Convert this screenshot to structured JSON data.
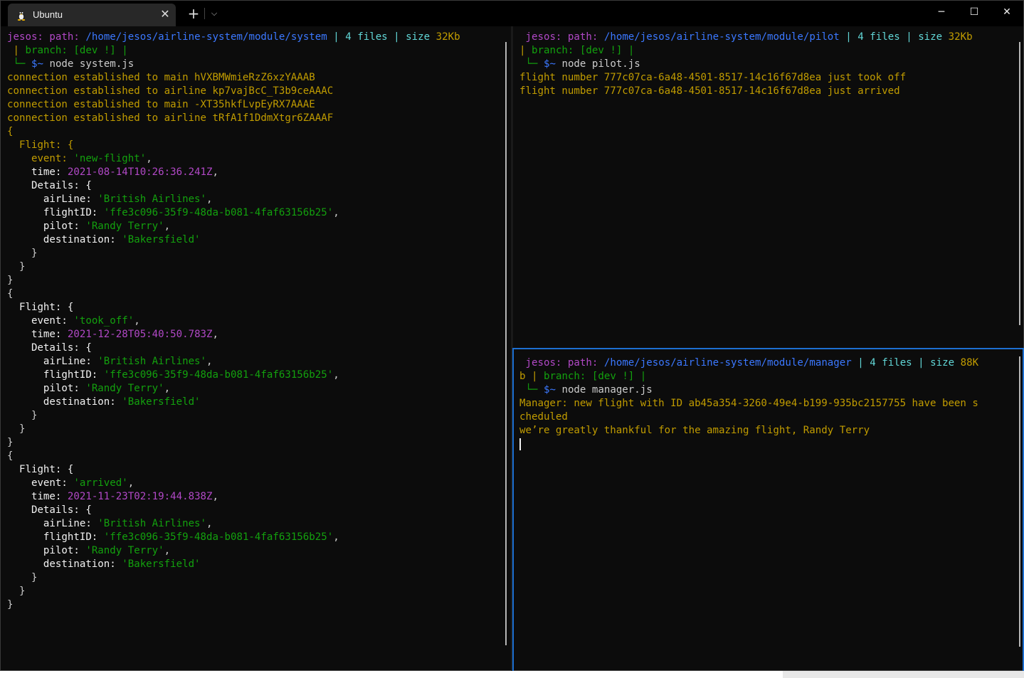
{
  "window": {
    "tab_title": "Ubuntu",
    "tab_icon": "linux-tux-icon",
    "tab_close": "✕",
    "new_tab": "+",
    "dropdown": "⌵",
    "minimize": "─",
    "maximize": "☐",
    "close": "✕"
  },
  "panes": {
    "system": {
      "prompt": {
        "user": "jesos:",
        "path_label": "path:",
        "path": "/home/jesos/airline-system/module/system",
        "sep1": "|",
        "files": "4 files",
        "sep2": "|",
        "size_label": "size",
        "size": "32Kb",
        "branch_prefix": " |",
        "branch_label": "branch:",
        "branch": "[dev !]",
        "branch_suffix": "|",
        "tree": " └─",
        "sym": "$~",
        "command": "node system.js"
      },
      "connections": [
        "connection established to main hVXBMWmieRzZ6xzYAAAB",
        "connection established to airline kp7vajBcC_T3b9ceAAAC",
        "connection established to main -XT35hkfLvpEyRX7AAAE",
        "connection established to airline tRfA1f1DdmXtgr6ZAAAF"
      ],
      "events": [
        {
          "event": "'new-flight'",
          "time": "2021-08-14T10:26:36.241Z",
          "airline": "'British Airlines'",
          "flightID": "'ffe3c096-35f9-48da-b081-4faf63156b25'",
          "pilot": "'Randy Terry'",
          "destination": "'Bakersfield'"
        },
        {
          "event": "'took_off'",
          "time": "2021-12-28T05:40:50.783Z",
          "airline": "'British Airlines'",
          "flightID": "'ffe3c096-35f9-48da-b081-4faf63156b25'",
          "pilot": "'Randy Terry'",
          "destination": "'Bakersfield'"
        },
        {
          "event": "'arrived'",
          "time": "2021-11-23T02:19:44.838Z",
          "airline": "'British Airlines'",
          "flightID": "'ffe3c096-35f9-48da-b081-4faf63156b25'",
          "pilot": "'Randy Terry'",
          "destination": "'Bakersfield'"
        }
      ]
    },
    "pilot": {
      "prompt": {
        "user": "jesos:",
        "path_label": "path:",
        "path": "/home/jesos/airline-system/module/pilot",
        "sep1": "|",
        "files": "4 files",
        "sep2": "|",
        "size_label": "size",
        "size": "32Kb",
        "branch_prefix": "|",
        "branch_label": "branch:",
        "branch": "[dev !]",
        "branch_suffix": "|",
        "tree": " └─",
        "sym": "$~",
        "command": "node pilot.js"
      },
      "lines": [
        "flight number 777c07ca-6a48-4501-8517-14c16f67d8ea just took off",
        "flight number 777c07ca-6a48-4501-8517-14c16f67d8ea just arrived"
      ]
    },
    "manager": {
      "prompt": {
        "user": "jesos:",
        "path_label": "path:",
        "path": "/home/jesos/airline-system/module/manager",
        "sep1": "|",
        "files": "4 files",
        "sep2": "|",
        "size_label": "size",
        "size": "88K",
        "size_wrap": "b",
        "branch_prefix": " |",
        "branch_label": "branch:",
        "branch": "[dev !]",
        "branch_suffix": "|",
        "tree": " └─",
        "sym": "$~",
        "command": "node manager.js"
      },
      "lines": [
        "Manager: new flight with ID ab45a354-3260-49e4-b199-935bc2157755 have been s",
        "cheduled",
        "we’re greatly thankful for the amazing flight, Randy Terry"
      ]
    }
  },
  "labels": {
    "open_brace": "{",
    "close_brace": "}",
    "flight_key": "Flight: {",
    "event_key": "event: ",
    "time_key": "time: ",
    "details_key": "Details: {",
    "airline_key": "airLine: ",
    "flightid_key": "flightID: ",
    "pilot_key": "pilot: ",
    "destination_key": "destination: ",
    "comma": ","
  },
  "colors": {
    "background": "#0c0c0c",
    "purple": "#b148c6",
    "blue": "#3b78ff",
    "cyan": "#61d6d6",
    "yellow": "#c19c00",
    "green": "#13a10e",
    "focus_border": "#1d6fd1"
  }
}
